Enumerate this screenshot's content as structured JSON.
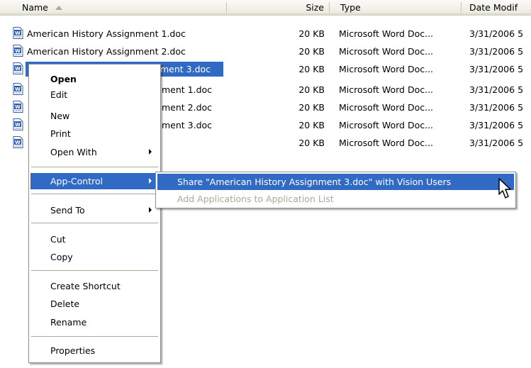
{
  "columns": {
    "name": "Name",
    "size": "Size",
    "type": "Type",
    "date": "Date Modif"
  },
  "files": [
    {
      "name": "American History Assignment 1.doc",
      "size": "20 KB",
      "type": "Microsoft Word Doc...",
      "date": "3/31/2006 5"
    },
    {
      "name": "American History Assignment 2.doc",
      "size": "20 KB",
      "type": "Microsoft Word Doc...",
      "date": "3/31/2006 5"
    },
    {
      "name": "ment 3.doc",
      "size": "20 KB",
      "type": "Microsoft Word Doc...",
      "date": "3/31/2006 5"
    },
    {
      "name": "ment 1.doc",
      "size": "20 KB",
      "type": "Microsoft Word Doc...",
      "date": "3/31/2006 5"
    },
    {
      "name": "ment 2.doc",
      "size": "20 KB",
      "type": "Microsoft Word Doc...",
      "date": "3/31/2006 5"
    },
    {
      "name": "ment 3.doc",
      "size": "20 KB",
      "type": "Microsoft Word Doc...",
      "date": "3/31/2006 5"
    },
    {
      "name": "",
      "size": "20 KB",
      "type": "Microsoft Word Doc...",
      "date": "3/31/2006 5"
    }
  ],
  "context_menu": {
    "open": "Open",
    "edit": "Edit",
    "new": "New",
    "print": "Print",
    "open_with": "Open With",
    "app_control": "App-Control",
    "send_to": "Send To",
    "cut": "Cut",
    "copy": "Copy",
    "create_shortcut": "Create Shortcut",
    "delete": "Delete",
    "rename": "Rename",
    "properties": "Properties"
  },
  "submenu": {
    "share": "Share \"American History Assignment 3.doc\" with Vision Users",
    "add_apps": "Add Applications to Application List"
  },
  "colors": {
    "selection": "#316ac5",
    "disabled_text": "#aca899"
  }
}
